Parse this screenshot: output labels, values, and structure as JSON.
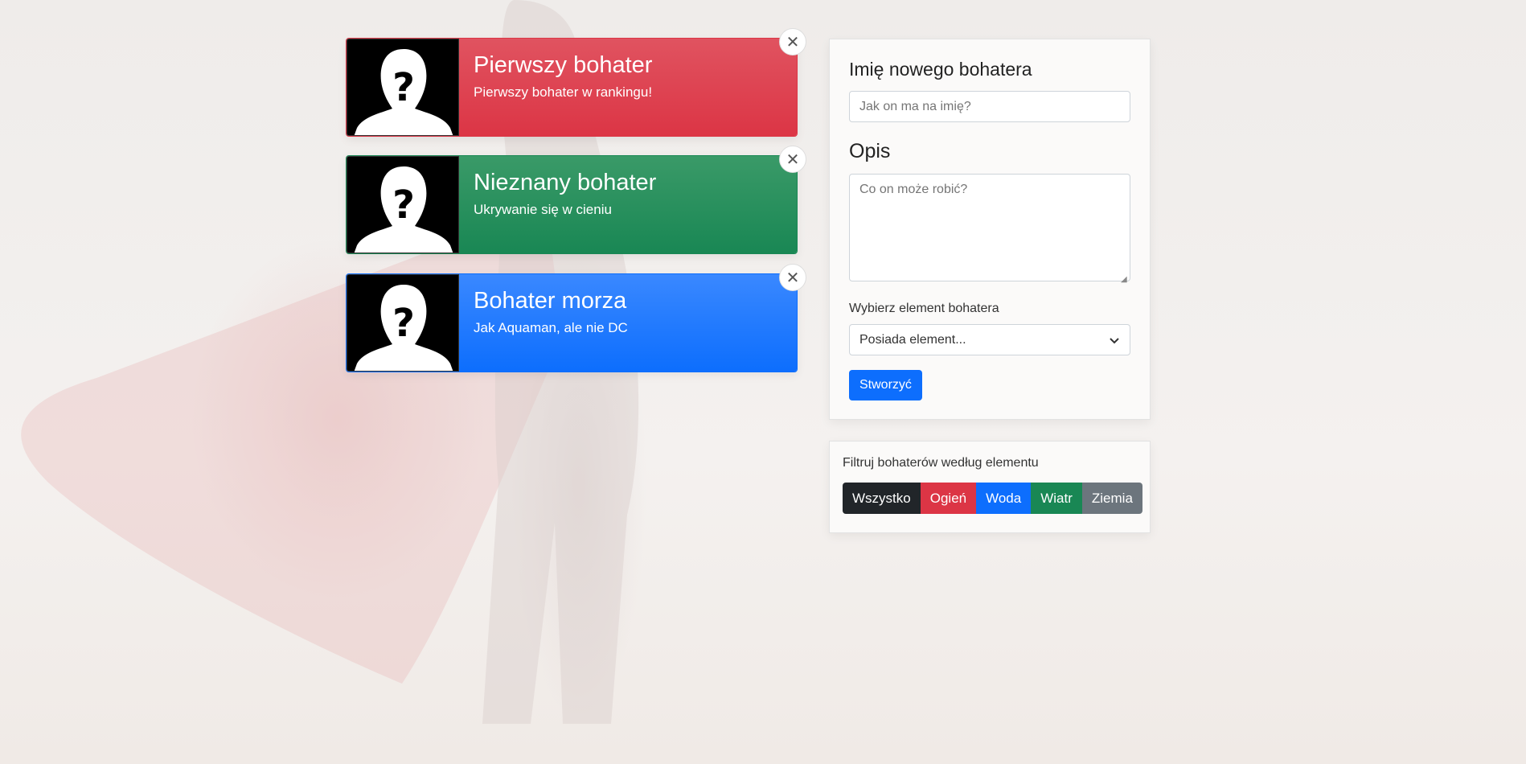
{
  "heroes": [
    {
      "name": "Pierwszy bohater",
      "description": "Pierwszy bohater w rankingu!",
      "color": "#dc3545"
    },
    {
      "name": "Nieznany bohater",
      "description": "Ukrywanie się w cieniu",
      "color": "#198754"
    },
    {
      "name": "Bohater morza",
      "description": "Jak Aquaman, ale nie DC",
      "color": "#0d6efd"
    }
  ],
  "form": {
    "name_heading": "Imię nowego bohatera",
    "name_placeholder": "Jak on ma na imię?",
    "desc_heading": "Opis",
    "desc_placeholder": "Co on może robić?",
    "element_label": "Wybierz element bohatera",
    "element_selected": "Posiada element...",
    "submit_label": "Stworzyć"
  },
  "filter": {
    "title": "Filtruj bohaterów według elementu",
    "buttons": [
      {
        "label": "Wszystko",
        "color": "#212529"
      },
      {
        "label": "Ogień",
        "color": "#dc3545"
      },
      {
        "label": "Woda",
        "color": "#0d6efd"
      },
      {
        "label": "Wiatr",
        "color": "#198754"
      },
      {
        "label": "Ziemia",
        "color": "#6c757d"
      }
    ]
  },
  "icons": {
    "close": "close-icon",
    "portrait": "unknown-person-icon",
    "dropdown": "chevron-down-icon"
  }
}
